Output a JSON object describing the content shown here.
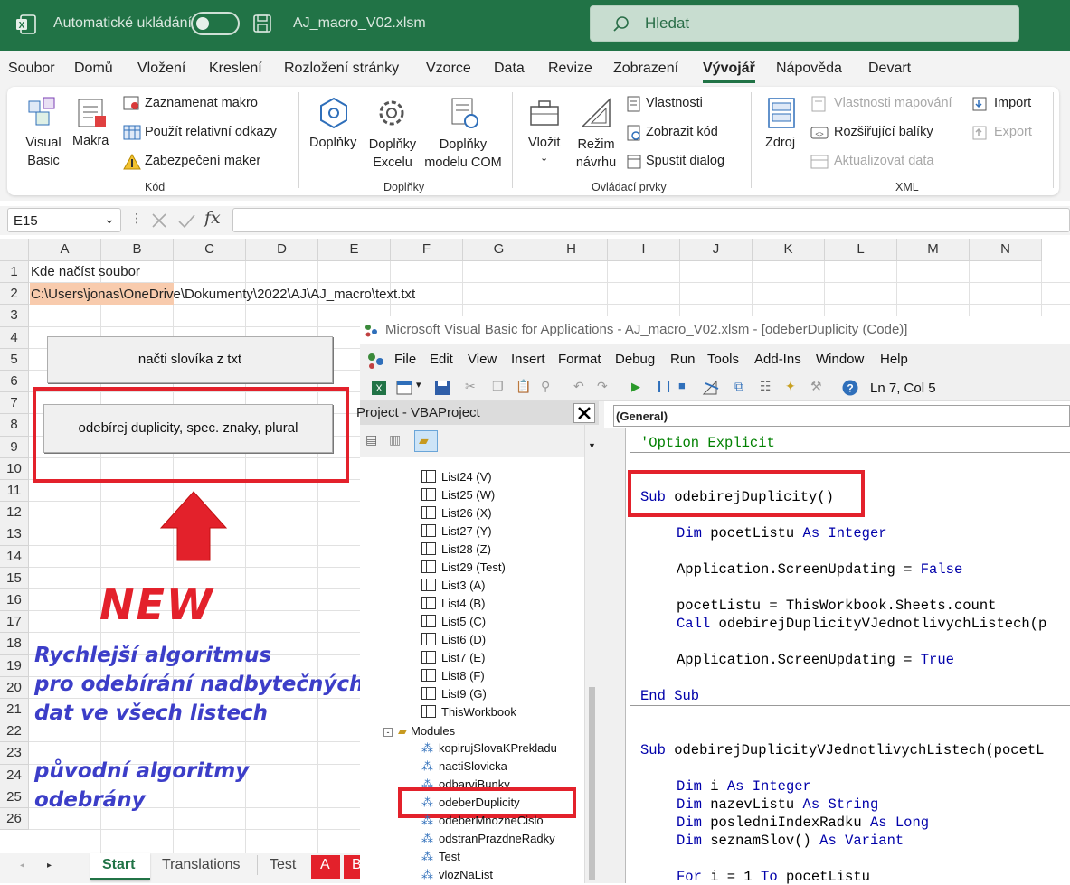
{
  "excel": {
    "autosave_label": "Automatické ukládání",
    "file_name": "AJ_macro_V02.xlsm",
    "search_placeholder": "Hledat",
    "menu": [
      "Soubor",
      "Domů",
      "Vložení",
      "Kreslení",
      "Rozložení stránky",
      "Vzorce",
      "Data",
      "Revize",
      "Zobrazení",
      "Vývojář",
      "Nápověda",
      "Devart"
    ],
    "active_menu": "Vývojář",
    "ribbon": {
      "visual_basic": [
        "Visual",
        "Basic"
      ],
      "makra": "Makra",
      "record_macro": "Zaznamenat makro",
      "relative_refs": "Použít relativní odkazy",
      "macro_security": "Zabezpečení maker",
      "group_kod": "Kód",
      "doplnky": "Doplňky",
      "doplnky_excelu": [
        "Doplňky",
        "Excelu"
      ],
      "doplnky_com": [
        "Doplňky",
        "modelu COM"
      ],
      "group_doplnky": "Doplňky",
      "vlozit": "Vložit",
      "rezim_navrhu": [
        "Režim",
        "návrhu"
      ],
      "vlastnosti": "Vlastnosti",
      "zobrazit_kod": "Zobrazit kód",
      "spustit_dialog": "Spustit dialog",
      "group_ovladaci": "Ovládací prvky",
      "zdroj": "Zdroj",
      "vlastnosti_mapovani": "Vlastnosti mapování",
      "rozsirujici_baliky": "Rozšiřující balíky",
      "aktualizovat_data": "Aktualizovat data",
      "import": "Import",
      "export": "Export",
      "group_xml": "XML"
    },
    "name_box": "E15",
    "fx": "fx",
    "columns": [
      "A",
      "B",
      "C",
      "D",
      "E",
      "F",
      "G",
      "H",
      "I",
      "J",
      "K",
      "L",
      "M",
      "N"
    ],
    "rows": [
      "1",
      "2",
      "3",
      "4",
      "5",
      "6",
      "7",
      "8",
      "9",
      "10",
      "11",
      "12",
      "13",
      "14",
      "15",
      "16",
      "17",
      "18",
      "19",
      "20",
      "21",
      "22",
      "23",
      "24",
      "25",
      "26"
    ],
    "cell_a1": "Kde načíst soubor",
    "cell_a2_part": "C:\\Users\\jonas\\OneD",
    "cell_a2_rest": "rive\\Dokumenty\\2022\\AJ\\AJ_macro\\text.txt",
    "button_load": "načti slovíka z txt",
    "button_dedupe": "odebírej duplicity, spec. znaky, plural",
    "new_label": "NEW",
    "note_lines": [
      "Rychlejší algoritmus",
      "pro odebírání nadbytečných",
      "dat ve všech listech",
      "",
      "původní algoritmy",
      "odebrány"
    ],
    "sheet_tabs": [
      "Start",
      "Translations",
      "Test",
      "A",
      "B"
    ],
    "active_tab": "Start"
  },
  "vbe": {
    "title": "Microsoft Visual Basic for Applications - AJ_macro_V02.xlsm - [odeberDuplicity (Code)]",
    "menu": [
      "File",
      "Edit",
      "View",
      "Insert",
      "Format",
      "Debug",
      "Run",
      "Tools",
      "Add-Ins",
      "Window",
      "Help"
    ],
    "position": "Ln 7, Col 5",
    "project_title": "Project - VBAProject",
    "general_dropdown": "(General)",
    "sheets": [
      "List24 (V)",
      "List25 (W)",
      "List26 (X)",
      "List27 (Y)",
      "List28 (Z)",
      "List29 (Test)",
      "List3 (A)",
      "List4 (B)",
      "List5 (C)",
      "List6 (D)",
      "List7 (E)",
      "List8 (F)",
      "List9 (G)",
      "ThisWorkbook"
    ],
    "modules_label": "Modules",
    "modules": [
      "kopirujSlovaKPrekladu",
      "nactiSlovicka",
      "odbarviBunky",
      "odeberDuplicity",
      "odeberMnozneCislo",
      "odstranPrazdneRadky",
      "Test",
      "vlozNaList"
    ],
    "selected_module": "odeberDuplicity",
    "code": {
      "option_explicit": "'Option Explicit",
      "sub1_kw": "Sub",
      "sub1_name": " odebirejDuplicity()",
      "dim1_kw": "Dim",
      "dim1_name": " pocetListu ",
      "as": "As",
      "integer": "Integer",
      "app1": "Application.ScreenUpdating = ",
      "false": "False",
      "pocet_assign": "pocetListu = ThisWorkbook.Sheets.count",
      "call_kw": "Call",
      "call_rest": " odebirejDuplicityVJednotlivychListech(p",
      "app2": "Application.ScreenUpdating = ",
      "true": "True",
      "end_sub": "End Sub",
      "sub2_name": " odebirejDuplicityVJednotlivychListech(pocetL",
      "dim_i": " i ",
      "dim_nazev": " nazevListu ",
      "string": "String",
      "dim_posledni": " posledniIndexRadku ",
      "long": "Long",
      "dim_seznam": " seznamSlov() ",
      "variant": "Variant",
      "for_kw": "For",
      "for_rest": " i = 1 ",
      "to_kw": "To",
      "for_end": " pocetListu"
    }
  }
}
